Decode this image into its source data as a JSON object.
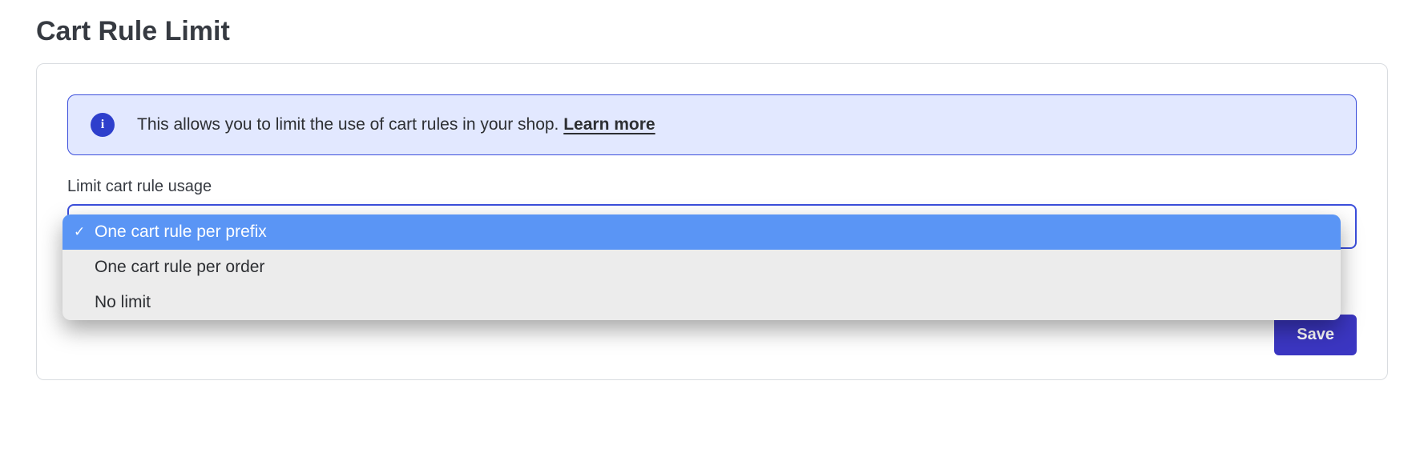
{
  "page": {
    "title": "Cart Rule Limit"
  },
  "banner": {
    "icon_name": "info",
    "icon_glyph": "i",
    "text": "This allows you to limit the use of cart rules in your shop. ",
    "learn_more_label": "Learn more"
  },
  "field": {
    "label": "Limit cart rule usage",
    "selected_value": "One cart rule per prefix",
    "options": [
      "One cart rule per prefix",
      "One cart rule per order",
      "No limit"
    ]
  },
  "actions": {
    "save_label": "Save"
  }
}
